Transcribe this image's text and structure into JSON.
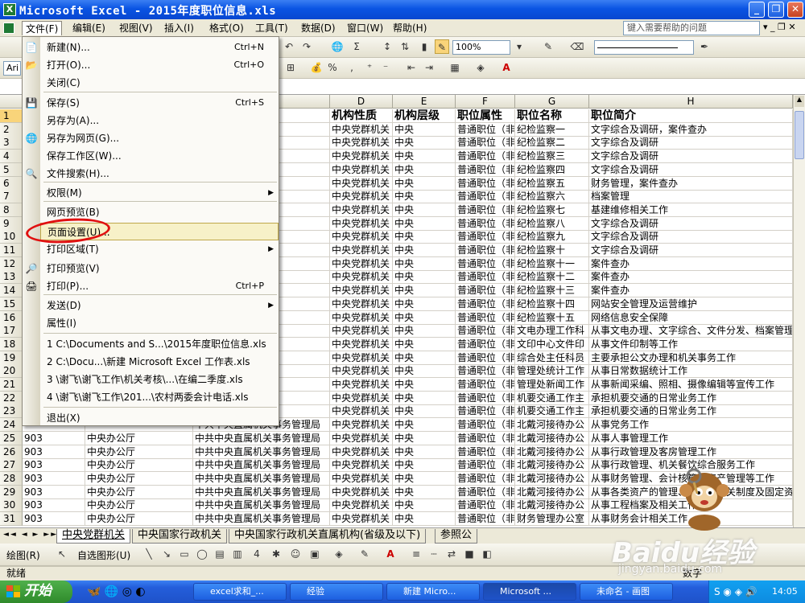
{
  "window": {
    "title": "Microsoft Excel - 2015年度职位信息.xls",
    "app_icon_letter": "X"
  },
  "menubar": {
    "items": [
      "文件(F)",
      "编辑(E)",
      "视图(V)",
      "插入(I)",
      "格式(O)",
      "工具(T)",
      "数据(D)",
      "窗口(W)",
      "帮助(H)"
    ],
    "help_placeholder": "键入需要帮助的问题"
  },
  "toolbar": {
    "zoom": "100%",
    "font_short": "Ari",
    "sigma": "Σ",
    "percent": "%"
  },
  "file_menu": {
    "items": [
      {
        "label": "新建(N)...",
        "shortcut": "Ctrl+N"
      },
      {
        "label": "打开(O)...",
        "shortcut": "Ctrl+O"
      },
      {
        "label": "关闭(C)",
        "shortcut": ""
      },
      {
        "label": "保存(S)",
        "shortcut": "Ctrl+S"
      },
      {
        "label": "另存为(A)...",
        "shortcut": ""
      },
      {
        "label": "另存为网页(G)...",
        "shortcut": ""
      },
      {
        "label": "保存工作区(W)...",
        "shortcut": ""
      },
      {
        "label": "文件搜索(H)...",
        "shortcut": ""
      },
      {
        "label": "权限(M)",
        "shortcut": ""
      },
      {
        "label": "网页预览(B)",
        "shortcut": ""
      },
      {
        "label": "页面设置(U)...",
        "shortcut": ""
      },
      {
        "label": "打印区域(T)",
        "shortcut": ""
      },
      {
        "label": "打印预览(V)",
        "shortcut": ""
      },
      {
        "label": "打印(P)...",
        "shortcut": "Ctrl+P"
      },
      {
        "label": "发送(D)",
        "shortcut": ""
      },
      {
        "label": "属性(I)",
        "shortcut": ""
      },
      {
        "label": "1 C:\\Documents and S...\\2015年度职位信息.xls",
        "shortcut": ""
      },
      {
        "label": "2 C:\\Docu...\\新建 Microsoft Excel 工作表.xls",
        "shortcut": ""
      },
      {
        "label": "3 \\谢飞\\谢飞工作\\机关考核\\...\\在编二季度.xls",
        "shortcut": ""
      },
      {
        "label": "4 \\谢飞\\谢飞工作\\201...\\农村两委会计电话.xls",
        "shortcut": ""
      },
      {
        "label": "退出(X)",
        "shortcut": ""
      }
    ]
  },
  "columns": [
    "D",
    "E",
    "F",
    "G",
    "H"
  ],
  "header_row": [
    "机构性质",
    "机构层级",
    "职位属性",
    "职位名称",
    "职位简介"
  ],
  "rows": [
    [
      "中央党群机关",
      "中央",
      "普通职位（非",
      "纪检监察一",
      "文字综合及调研，案件查办"
    ],
    [
      "中央党群机关",
      "中央",
      "普通职位（非",
      "纪检监察二",
      "文字综合及调研"
    ],
    [
      "中央党群机关",
      "中央",
      "普通职位（非",
      "纪检监察三",
      "文字综合及调研"
    ],
    [
      "中央党群机关",
      "中央",
      "普通职位（非",
      "纪检监察四",
      "文字综合及调研"
    ],
    [
      "中央党群机关",
      "中央",
      "普通职位（非",
      "纪检监察五",
      "财务管理，案件查办"
    ],
    [
      "中央党群机关",
      "中央",
      "普通职位（非",
      "纪检监察六",
      "档案管理"
    ],
    [
      "中央党群机关",
      "中央",
      "普通职位（非",
      "纪检监察七",
      "基建维修相关工作"
    ],
    [
      "中央党群机关",
      "中央",
      "普通职位（非",
      "纪检监察八",
      "文字综合及调研"
    ],
    [
      "中央党群机关",
      "中央",
      "普通职位（非",
      "纪检监察九",
      "文字综合及调研"
    ],
    [
      "中央党群机关",
      "中央",
      "普通职位（非",
      "纪检监察十",
      "文字综合及调研"
    ],
    [
      "中央党群机关",
      "中央",
      "普通职位（非",
      "纪检监察十一",
      "案件查办"
    ],
    [
      "中央党群机关",
      "中央",
      "普通职位（非",
      "纪检监察十二",
      "案件查办"
    ],
    [
      "中央党群机关",
      "中央",
      "普通职位（非",
      "纪检监察十三",
      "案件查办"
    ],
    [
      "中央党群机关",
      "中央",
      "普通职位（非",
      "纪检监察十四",
      "网站安全管理及运营维护"
    ],
    [
      "中央党群机关",
      "中央",
      "普通职位（非",
      "纪检监察十五",
      "网络信息安全保障"
    ],
    [
      "中央党群机关",
      "中央",
      "普通职位（非",
      "文电办理工作科",
      "从事文电办理、文字综合、文件分发、档案管理"
    ],
    [
      "中央党群机关",
      "中央",
      "普通职位（非",
      "文印中心文件印",
      "从事文件印制等工作"
    ],
    [
      "中央党群机关",
      "中央",
      "普通职位（非",
      "综合处主任科员",
      "主要承担公文办理和机关事务工作"
    ],
    [
      "中央党群机关",
      "中央",
      "普通职位（非",
      "管理处统计工作",
      "从事日常数据统计工作"
    ],
    [
      "中央党群机关",
      "中央",
      "普通职位（非",
      "管理处新闻工作",
      "从事新闻采编、照相、摄像编辑等宣传工作"
    ],
    [
      "中央党群机关",
      "中央",
      "普通职位（非",
      "机要交通工作主",
      "承担机要交通的日常业务工作"
    ],
    [
      "中央党群机关",
      "中央",
      "普通职位（非",
      "机要交通工作主",
      "承担机要交通的日常业务工作"
    ],
    [
      "中央党群机关",
      "中央",
      "普通职位（非",
      "北戴河接待办公",
      "从事党务工作"
    ],
    [
      "中央党群机关",
      "中央",
      "普通职位（非",
      "北戴河接待办公",
      "从事人事管理工作"
    ],
    [
      "中央党群机关",
      "中央",
      "普通职位（非",
      "北戴河接待办公",
      "从事行政管理及客房管理工作"
    ],
    [
      "中央党群机关",
      "中央",
      "普通职位（非",
      "北戴河接待办公",
      "从事行政管理、机关餐饮综合服务工作"
    ],
    [
      "中央党群机关",
      "中央",
      "普通职位（非",
      "北戴河接待办公",
      "从事财务管理、会计核算、资产管理等工作"
    ],
    [
      "中央党群机关",
      "中央",
      "普通职位（非",
      "北戴河接待办公",
      "从事各类资产的管理、维护，相关制度及固定资产"
    ],
    [
      "中央党群机关",
      "中央",
      "普通职位（非",
      "北戴河接待办公",
      "从事工程档案及相关工作"
    ],
    [
      "中央党群机关",
      "中央",
      "普通职位（非",
      "财务管理办公室",
      "从事财务会计相关工作"
    ]
  ],
  "left_rows": [
    {
      "row": 24,
      "a": "",
      "b": "",
      "c": "中共中央直属机关事务管理局"
    },
    {
      "row": 25,
      "a": "903",
      "b": "中央办公厅",
      "c": "中共中央直属机关事务管理局"
    },
    {
      "row": 26,
      "a": "903",
      "b": "中央办公厅",
      "c": "中共中央直属机关事务管理局"
    },
    {
      "row": 27,
      "a": "903",
      "b": "中央办公厅",
      "c": "中共中央直属机关事务管理局"
    },
    {
      "row": 28,
      "a": "903",
      "b": "中央办公厅",
      "c": "中共中央直属机关事务管理局"
    },
    {
      "row": 29,
      "a": "903",
      "b": "中央办公厅",
      "c": "中共中央直属机关事务管理局"
    },
    {
      "row": 30,
      "a": "903",
      "b": "中央办公厅",
      "c": "中共中央直属机关事务管理局"
    },
    {
      "row": 31,
      "a": "903",
      "b": "中央办公厅",
      "c": "中共中央直属机关事务管理局"
    }
  ],
  "sheet_tabs": [
    "中央党群机关",
    "中央国家行政机关",
    "中央国家行政机关直属机构(省级及以下)",
    "参照公"
  ],
  "drawbar": {
    "draw_label": "绘图(R)",
    "autoshape_label": "自选图形(U)"
  },
  "status": {
    "left": "就绪",
    "right": "数字"
  },
  "taskbar": {
    "start": "开始",
    "buttons": [
      "excel求和_...",
      "经验",
      "新建 Micro...",
      "Microsoft ...",
      "未命名 - 画图"
    ],
    "clock": "14:05"
  },
  "watermark": {
    "logo": "Baidu经验",
    "url": "jingyan.baidu.com"
  }
}
